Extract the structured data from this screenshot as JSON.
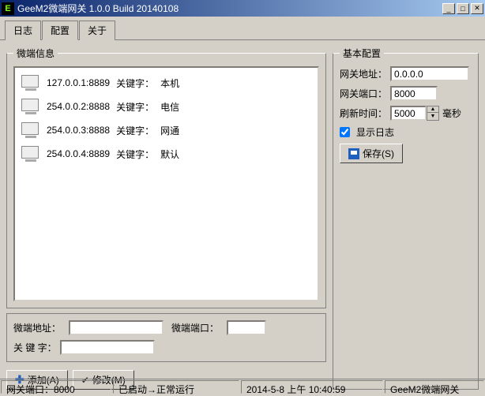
{
  "window": {
    "icon_letter": "E",
    "title": "GeeM2微端网关 1.0.0 Build 20140108"
  },
  "tabs": [
    "日志",
    "配置",
    "关于"
  ],
  "active_tab": 1,
  "left_panel": {
    "legend": "微端信息",
    "items": [
      {
        "addr": "127.0.0.1:8889",
        "kwlabel": "关键字：",
        "keyword": "本机"
      },
      {
        "addr": "254.0.0.2:8888",
        "kwlabel": "关键字：",
        "keyword": "电信"
      },
      {
        "addr": "254.0.0.3:8888",
        "kwlabel": "关键字：",
        "keyword": "网通"
      },
      {
        "addr": "254.0.0.4:8889",
        "kwlabel": "关键字：",
        "keyword": "默认"
      }
    ],
    "field_labels": {
      "addr": "微端地址：",
      "port": "微端端口：",
      "keyword": "关 键 字："
    },
    "field_values": {
      "addr": "",
      "port": "",
      "keyword": ""
    },
    "buttons": {
      "add": "添加(A)",
      "modify": "修改(M)"
    }
  },
  "right_panel": {
    "legend": "基本配置",
    "labels": {
      "gw_addr": "网关地址：",
      "gw_port": "网关端口：",
      "refresh": "刷新时间：",
      "ms": "毫秒",
      "show_log": "显示日志",
      "save": "保存(S)"
    },
    "values": {
      "gw_addr": "0.0.0.0",
      "gw_port": "8000",
      "refresh": "5000",
      "show_log": true
    }
  },
  "statusbar": {
    "port": "网关端口：8000",
    "state": "已启动→正常运行",
    "datetime": "2014-5-8 上午 10:40:59",
    "app": "GeeM2微端网关"
  }
}
